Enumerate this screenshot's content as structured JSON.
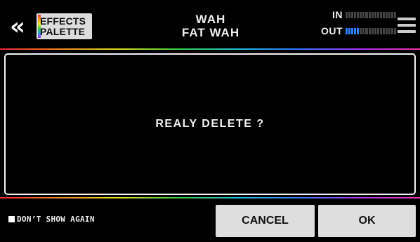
{
  "header": {
    "back_glyph": "«",
    "palette_line1": "EFFECTS",
    "palette_line2": "PALETTE",
    "effect_category": "WAH",
    "effect_name": "FAT WAH",
    "meters": {
      "in_label": "IN",
      "out_label": "OUT",
      "in_level": 0,
      "out_level": 0.25
    }
  },
  "dialog": {
    "message": "REALY DELETE ?"
  },
  "footer": {
    "dont_show_label": "DON’T SHOW AGAIN",
    "dont_show_checked": false,
    "cancel_label": "CANCEL",
    "ok_label": "OK"
  },
  "colors": {
    "meter_active": "#2f7fff",
    "meter_inactive": "#444444",
    "button_bg": "#dedede"
  },
  "icons": {
    "back": "double-chevron-left-icon",
    "menu": "hamburger-menu-icon"
  }
}
